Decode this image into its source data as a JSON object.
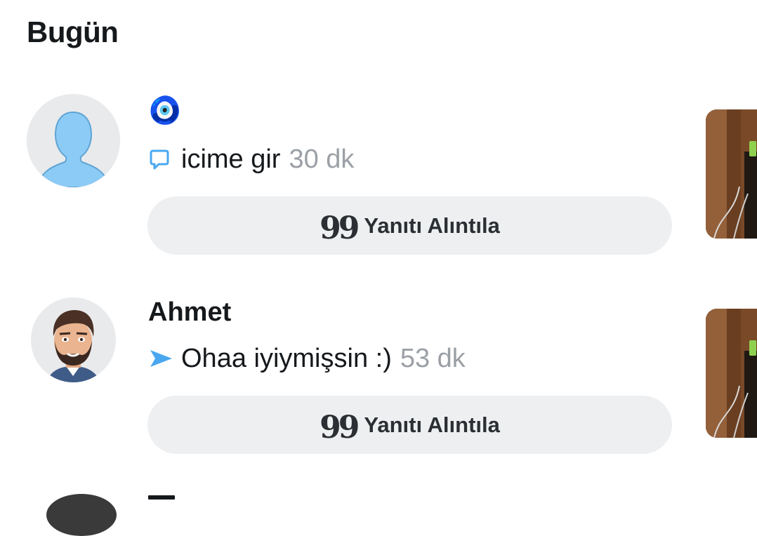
{
  "section": {
    "title": "Bugün"
  },
  "conversations": [
    {
      "name": "🧿",
      "message_icon": "chat-bubble-outline-icon",
      "message": "icime gir",
      "time": "30 dk",
      "quote_button_label": "Yanıtı Alıntıla",
      "avatar": "default-silhouette-avatar"
    },
    {
      "name": "Ahmet",
      "message_icon": "sent-arrow-icon",
      "message": "Ohaa iyiymişsin :)",
      "time": "53 dk",
      "quote_button_label": "Yanıtı Alıntıla",
      "avatar": "bitmoji-avatar"
    }
  ],
  "quote_glyph": "99",
  "colors": {
    "accent_blue": "#4aa8f0",
    "silhouette_blue": "#8ccbf5",
    "muted_text": "#9ba0a6",
    "button_bg": "#eeeff1"
  }
}
